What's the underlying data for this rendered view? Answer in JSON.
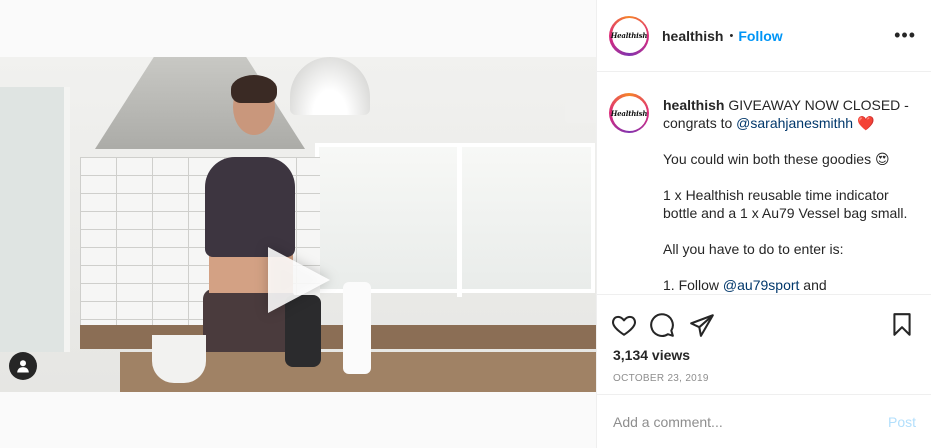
{
  "post": {
    "username": "healthish",
    "follow_separator": "•",
    "follow_label": "Follow",
    "avatar_text": "Healthish",
    "more_label": "•••",
    "caption": {
      "username": "healthish",
      "line1_rest": " GIVEAWAY NOW CLOSED - congrats to ",
      "mention1": "@sarahjanesmithh",
      "emoji1": "❤️",
      "para2": "You could win both these goodies 😍",
      "para3": "1 x Healthish reusable time indicator bottle and a 1 x Au79 Vessel bag small.",
      "para4": "All you have to do to enter is:",
      "para5_prefix": "1. Follow ",
      "mention2": "@au79sport",
      "para5_suffix": " and"
    },
    "views": "3,134 views",
    "date": "OCTOBER 23, 2019",
    "comment_placeholder": "Add a comment...",
    "post_label": "Post"
  },
  "icons": {
    "like": "heart-icon",
    "comment": "comment-icon",
    "share": "share-icon",
    "save": "bookmark-icon",
    "play": "play-icon",
    "tagged_user": "user-icon"
  }
}
